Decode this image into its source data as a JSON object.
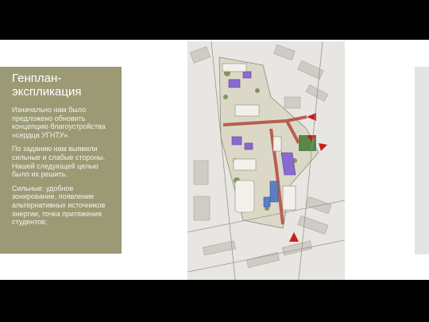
{
  "slide": {
    "title": "Генплан-экспликация",
    "paragraphs": [
      "Изначально нам было предложено обновить концепцию благоустройства «сердца УГНТУ».",
      "По заданию нам выявили сильные и слабые стороны. Нашей следующей целью было их решить.",
      "Сильные: удобное зонирование, появление альтернативных источников энергии, точка притяжения студентов;"
    ]
  },
  "plan": {
    "kind": "master-plan-drawing",
    "colors": {
      "background": "#e8e6e2",
      "buildings_purple": "#8a6ad0",
      "buildings_blue": "#5b7fc4",
      "paths_red": "#b14a3a",
      "greenery": "#6f8d4a",
      "arrows": "#c81e1e"
    }
  },
  "colors": {
    "panel": "#9b9a75",
    "page": "#000000",
    "slide": "#ffffff"
  }
}
